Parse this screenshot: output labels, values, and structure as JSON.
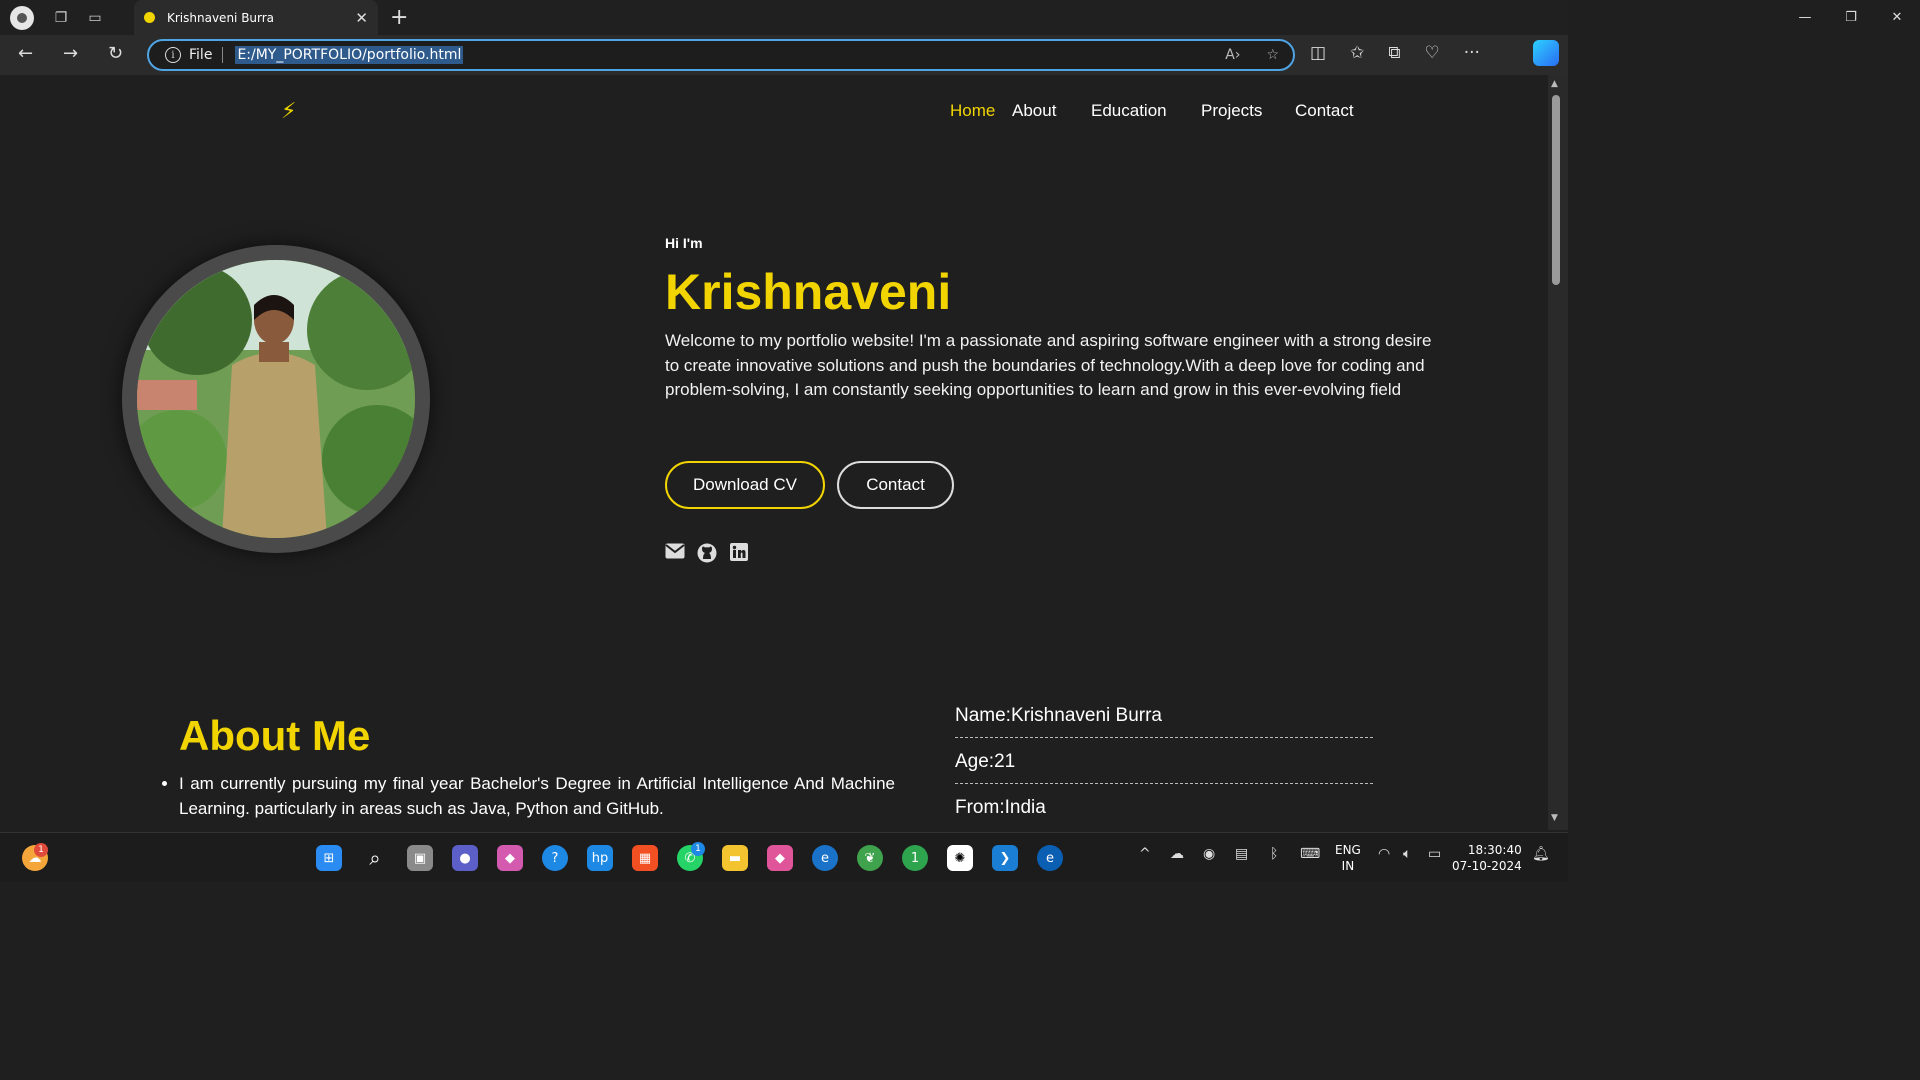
{
  "browser": {
    "tab_title": "Krishnaveni Burra",
    "address_scheme": "File",
    "url": "E:/MY_PORTFOLIO/portfolio.html"
  },
  "nav": {
    "items": [
      "Home",
      "About",
      "Education",
      "Projects",
      "Contact"
    ],
    "active": "Home"
  },
  "hero": {
    "greeting": "Hi I'm",
    "name": "Krishnaveni",
    "intro": "Welcome to my portfolio website! I'm a passionate and aspiring software engineer with a strong desire to create innovative solutions and push the boundaries of technology.With a deep love for coding and problem-solving, I am constantly seeking opportunities to learn and grow in this ever-evolving field",
    "download_cv_label": "Download CV",
    "contact_label": "Contact"
  },
  "about": {
    "title": "About Me",
    "bullet1": "I am currently pursuing my final year Bachelor's Degree in Artificial Intelligence And Machine Learning. particularly in areas such as Java, Python and GitHub.",
    "info": [
      "Name:Krishnaveni Burra",
      "Age:21",
      "From:India"
    ]
  },
  "taskbar": {
    "weather_badge": "1",
    "whatsapp_badge": "1",
    "lang_top": "ENG",
    "lang_bottom": "IN",
    "time": "18:30:40",
    "date": "07-10-2024"
  },
  "colors": {
    "accent": "#f1d400",
    "background": "#1f1f1f"
  }
}
